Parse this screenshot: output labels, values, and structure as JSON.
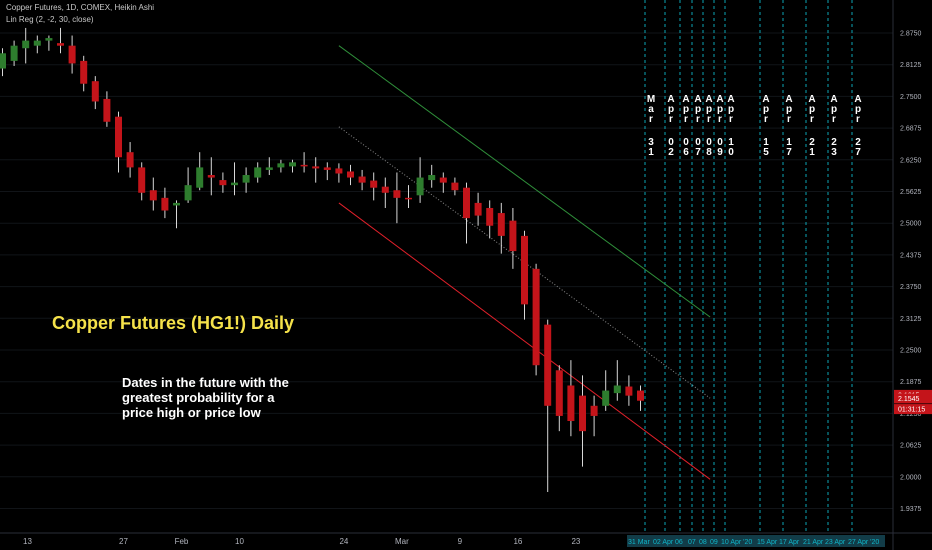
{
  "legend": {
    "line1": "Copper Futures, 1D, COMEX, Heikin Ashi",
    "line2": "Lin Reg (2, -2, 30, close)"
  },
  "headline": "Copper Futures (HG1!) Daily",
  "note_lines": [
    "Dates in the future with the",
    "greatest probability for a",
    "price high or price low"
  ],
  "colors": {
    "up": "#2e7d2e",
    "down": "#c4141a",
    "upper_channel": "#2f8f3a",
    "lower_channel": "#e0202a",
    "mid_channel": "#8a8a8a",
    "future_lines": "#0fb5c8",
    "headline": "#f5e24a"
  },
  "chart_data": {
    "type": "candlestick",
    "ylim": [
      1.925,
      2.88
    ],
    "y_ticks": [
      "2.8750",
      "2.8125",
      "2.7500",
      "2.6875",
      "2.6250",
      "2.5625",
      "2.5000",
      "2.4375",
      "2.3750",
      "2.3125",
      "2.2500",
      "2.1875",
      "2.1250",
      "2.0625",
      "2.0000",
      "1.9375"
    ],
    "x_ticks": [
      {
        "label": "13",
        "i": 0
      },
      {
        "label": "27",
        "i": 10
      },
      {
        "label": "Feb",
        "i": 15
      },
      {
        "label": "10",
        "i": 20
      },
      {
        "label": "24",
        "i": 29
      },
      {
        "label": "Mar",
        "i": 34
      },
      {
        "label": "9",
        "i": 39
      },
      {
        "label": "16",
        "i": 44
      },
      {
        "label": "23",
        "i": 49
      }
    ],
    "candles": [
      {
        "o": 2.805,
        "h": 2.845,
        "l": 2.79,
        "c": 2.835
      },
      {
        "o": 2.82,
        "h": 2.86,
        "l": 2.81,
        "c": 2.85
      },
      {
        "o": 2.845,
        "h": 2.885,
        "l": 2.815,
        "c": 2.86
      },
      {
        "o": 2.85,
        "h": 2.87,
        "l": 2.835,
        "c": 2.86
      },
      {
        "o": 2.86,
        "h": 2.87,
        "l": 2.84,
        "c": 2.865
      },
      {
        "o": 2.855,
        "h": 2.885,
        "l": 2.835,
        "c": 2.85
      },
      {
        "o": 2.85,
        "h": 2.87,
        "l": 2.795,
        "c": 2.815
      },
      {
        "o": 2.82,
        "h": 2.83,
        "l": 2.76,
        "c": 2.775
      },
      {
        "o": 2.78,
        "h": 2.79,
        "l": 2.725,
        "c": 2.74
      },
      {
        "o": 2.745,
        "h": 2.76,
        "l": 2.69,
        "c": 2.7
      },
      {
        "o": 2.71,
        "h": 2.72,
        "l": 2.6,
        "c": 2.63
      },
      {
        "o": 2.64,
        "h": 2.66,
        "l": 2.59,
        "c": 2.61
      },
      {
        "o": 2.61,
        "h": 2.62,
        "l": 2.545,
        "c": 2.56
      },
      {
        "o": 2.565,
        "h": 2.59,
        "l": 2.525,
        "c": 2.545
      },
      {
        "o": 2.55,
        "h": 2.57,
        "l": 2.51,
        "c": 2.525
      },
      {
        "o": 2.535,
        "h": 2.545,
        "l": 2.49,
        "c": 2.54
      },
      {
        "o": 2.545,
        "h": 2.61,
        "l": 2.54,
        "c": 2.575
      },
      {
        "o": 2.57,
        "h": 2.64,
        "l": 2.565,
        "c": 2.61
      },
      {
        "o": 2.595,
        "h": 2.63,
        "l": 2.555,
        "c": 2.59
      },
      {
        "o": 2.585,
        "h": 2.6,
        "l": 2.56,
        "c": 2.575
      },
      {
        "o": 2.575,
        "h": 2.62,
        "l": 2.555,
        "c": 2.58
      },
      {
        "o": 2.58,
        "h": 2.61,
        "l": 2.56,
        "c": 2.595
      },
      {
        "o": 2.59,
        "h": 2.62,
        "l": 2.58,
        "c": 2.61
      },
      {
        "o": 2.605,
        "h": 2.63,
        "l": 2.595,
        "c": 2.61
      },
      {
        "o": 2.61,
        "h": 2.625,
        "l": 2.6,
        "c": 2.618
      },
      {
        "o": 2.612,
        "h": 2.625,
        "l": 2.6,
        "c": 2.62
      },
      {
        "o": 2.615,
        "h": 2.64,
        "l": 2.6,
        "c": 2.612
      },
      {
        "o": 2.612,
        "h": 2.63,
        "l": 2.58,
        "c": 2.608
      },
      {
        "o": 2.61,
        "h": 2.62,
        "l": 2.585,
        "c": 2.605
      },
      {
        "o": 2.608,
        "h": 2.618,
        "l": 2.58,
        "c": 2.598
      },
      {
        "o": 2.602,
        "h": 2.615,
        "l": 2.575,
        "c": 2.59
      },
      {
        "o": 2.592,
        "h": 2.605,
        "l": 2.565,
        "c": 2.58
      },
      {
        "o": 2.584,
        "h": 2.6,
        "l": 2.545,
        "c": 2.57
      },
      {
        "o": 2.572,
        "h": 2.59,
        "l": 2.53,
        "c": 2.56
      },
      {
        "o": 2.565,
        "h": 2.6,
        "l": 2.5,
        "c": 2.55
      },
      {
        "o": 2.55,
        "h": 2.575,
        "l": 2.53,
        "c": 2.548
      },
      {
        "o": 2.555,
        "h": 2.63,
        "l": 2.54,
        "c": 2.59
      },
      {
        "o": 2.585,
        "h": 2.615,
        "l": 2.57,
        "c": 2.595
      },
      {
        "o": 2.59,
        "h": 2.6,
        "l": 2.56,
        "c": 2.58
      },
      {
        "o": 2.58,
        "h": 2.59,
        "l": 2.555,
        "c": 2.565
      },
      {
        "o": 2.57,
        "h": 2.58,
        "l": 2.46,
        "c": 2.51
      },
      {
        "o": 2.54,
        "h": 2.56,
        "l": 2.495,
        "c": 2.515
      },
      {
        "o": 2.53,
        "h": 2.545,
        "l": 2.47,
        "c": 2.495
      },
      {
        "o": 2.52,
        "h": 2.54,
        "l": 2.44,
        "c": 2.475
      },
      {
        "o": 2.505,
        "h": 2.53,
        "l": 2.41,
        "c": 2.445
      },
      {
        "o": 2.475,
        "h": 2.485,
        "l": 2.31,
        "c": 2.34
      },
      {
        "o": 2.41,
        "h": 2.42,
        "l": 2.2,
        "c": 2.22
      },
      {
        "o": 2.3,
        "h": 2.31,
        "l": 1.97,
        "c": 2.14
      },
      {
        "o": 2.21,
        "h": 2.22,
        "l": 2.09,
        "c": 2.12
      },
      {
        "o": 2.18,
        "h": 2.23,
        "l": 2.08,
        "c": 2.11
      },
      {
        "o": 2.16,
        "h": 2.2,
        "l": 2.02,
        "c": 2.09
      },
      {
        "o": 2.14,
        "h": 2.16,
        "l": 2.08,
        "c": 2.12
      },
      {
        "o": 2.14,
        "h": 2.21,
        "l": 2.13,
        "c": 2.17
      },
      {
        "o": 2.165,
        "h": 2.23,
        "l": 2.15,
        "c": 2.18
      },
      {
        "o": 2.178,
        "h": 2.2,
        "l": 2.14,
        "c": 2.16
      },
      {
        "o": 2.17,
        "h": 2.18,
        "l": 2.13,
        "c": 2.15
      }
    ],
    "channel": {
      "i_start": 29,
      "i_end": 61,
      "upper": [
        2.85,
        2.315
      ],
      "middle": [
        2.69,
        2.155
      ],
      "lower": [
        2.54,
        1.995
      ]
    },
    "future_dates": [
      {
        "month": "Mar",
        "day": "31",
        "axis_label": "31 Mar"
      },
      {
        "month": "Apr",
        "day": "02",
        "axis_label": "02 Apr"
      },
      {
        "month": "Apr",
        "day": "06",
        "axis_label": "06"
      },
      {
        "month": "Apr",
        "day": "07",
        "axis_label": "07"
      },
      {
        "month": "Apr",
        "day": "08",
        "axis_label": "08"
      },
      {
        "month": "Apr",
        "day": "09",
        "axis_label": "09"
      },
      {
        "month": "Apr",
        "day": "10",
        "axis_label": "10 Apr '20"
      },
      {
        "month": "Apr",
        "day": "15",
        "axis_label": "15 Apr"
      },
      {
        "month": "Apr",
        "day": "17",
        "axis_label": "17 Apr"
      },
      {
        "month": "Apr",
        "day": "21",
        "axis_label": "21 Apr"
      },
      {
        "month": "Apr",
        "day": "23",
        "axis_label": "23 Apr"
      },
      {
        "month": "Apr",
        "day": "27",
        "axis_label": "27 Apr '20"
      }
    ],
    "price_labels": [
      {
        "text": "2.1615",
        "value": 2.1615,
        "color": "#c4141a"
      },
      {
        "text": "2.1545",
        "value": 2.1545,
        "color": "#c4141a"
      },
      {
        "text": "01:31:15",
        "value": 2.1335,
        "color": "#c4141a"
      }
    ]
  }
}
